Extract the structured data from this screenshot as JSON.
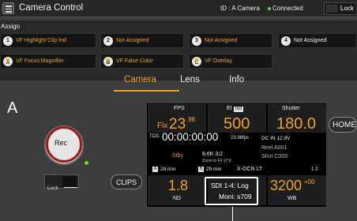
{
  "titlebar": {
    "title": "Camera Control",
    "camera_id": "ID : A Camera",
    "status": "Connected",
    "status_color": "#4cd964",
    "lock_label": "Lock"
  },
  "assign": {
    "title": "Assign",
    "buttons": [
      {
        "key": "1",
        "label": "VF Highlight Clip Ind"
      },
      {
        "key": "2",
        "label": "Not Assigned"
      },
      {
        "key": "3",
        "label": "Not Assigned"
      },
      {
        "key": "4",
        "label": "Not Assigned"
      },
      {
        "key": "A",
        "label": "VF Focus Magnifier"
      },
      {
        "key": "B",
        "label": "VF False Color"
      },
      {
        "key": "C",
        "label": "VF Overlay"
      }
    ]
  },
  "tabs": [
    {
      "label": "Camera"
    },
    {
      "label": "Lens"
    },
    {
      "label": "Info"
    }
  ],
  "camera_letter": "A",
  "rec_label": "Rec",
  "lock_switch_label": "Lock",
  "clips_label": "CLIPS",
  "home_label": "HOME",
  "status_panel": {
    "fps": {
      "label": "FPS",
      "prefix": "Fix",
      "value": "23",
      "decimal": ".98"
    },
    "ei": {
      "label": "EI",
      "badge": "ISO",
      "value": "500"
    },
    "shutter": {
      "label": "Shutter",
      "value": "180.0"
    },
    "timecode": {
      "label": "TCG",
      "value": "00:00:00:00",
      "rate": "23.98fps"
    },
    "dc_in": "DC IN  12.8V",
    "standby": "Stby",
    "resolution": "8.6K 3:2",
    "zoom_fit": "Zoom to Fit 17:9",
    "reel": "Reel  A001",
    "shot": "Shot  C003",
    "media_a": {
      "badge": "A",
      "time": "28 min"
    },
    "media_b": {
      "badge": "B",
      "time": "29 min"
    },
    "codec": "X-OCN LT",
    "slot_indices": "1   2",
    "nd": {
      "label": "ND",
      "value": "1.8"
    },
    "sdi": {
      "line1": "SDI 1-4: Log",
      "line2": "Moni: s709"
    },
    "wb": {
      "label": "WB",
      "value": "3200",
      "offset": "+00"
    }
  }
}
